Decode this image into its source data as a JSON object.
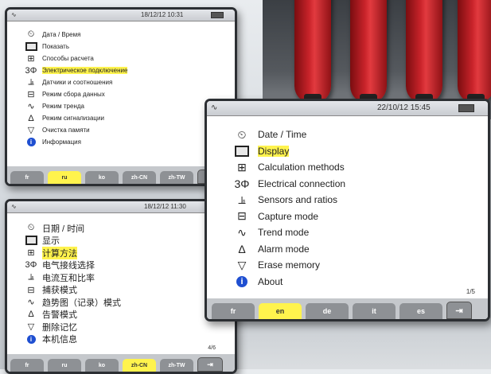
{
  "screen_ru": {
    "datetime": "18/12/12 10:31",
    "items": [
      {
        "icon": "clock-icon",
        "label": "Дата / Время"
      },
      {
        "icon": "display-icon",
        "label": "Показать"
      },
      {
        "icon": "calculation-icon",
        "label": "Способы расчета"
      },
      {
        "icon": "three-phase-icon",
        "label": "Электрическое подключение"
      },
      {
        "icon": "sensor-icon",
        "label": "Датчики и соотношения"
      },
      {
        "icon": "capture-icon",
        "label": "Режим сбора данных"
      },
      {
        "icon": "trend-icon",
        "label": "Режим тренда"
      },
      {
        "icon": "alarm-bell-icon",
        "label": "Режим сигнализации"
      },
      {
        "icon": "trash-icon",
        "label": "Очистка памяти"
      },
      {
        "icon": "info-icon",
        "label": "Информация"
      }
    ],
    "selected_index": 3,
    "tabs": [
      "fr",
      "ru",
      "ko",
      "zh-CN",
      "zh-TW"
    ],
    "selected_tab": 1
  },
  "screen_zh": {
    "datetime": "18/12/12 11:30",
    "items": [
      {
        "icon": "clock-icon",
        "label": "日期 / 时间"
      },
      {
        "icon": "display-icon",
        "label": "显示"
      },
      {
        "icon": "calculation-icon",
        "label": "计算方法"
      },
      {
        "icon": "three-phase-icon",
        "label": "电气接线选择"
      },
      {
        "icon": "sensor-icon",
        "label": "电流互和比率"
      },
      {
        "icon": "capture-icon",
        "label": "捕获模式"
      },
      {
        "icon": "trend-icon",
        "label": "趋势图（记录）模式"
      },
      {
        "icon": "alarm-bell-icon",
        "label": "告警模式"
      },
      {
        "icon": "trash-icon",
        "label": "删除记忆"
      },
      {
        "icon": "info-icon",
        "label": "本机信息"
      }
    ],
    "selected_index": 2,
    "tabs": [
      "fr",
      "ru",
      "ko",
      "zh-CN",
      "zh-TW"
    ],
    "selected_tab": 3,
    "page_indicator": "4/6"
  },
  "screen_en": {
    "datetime": "22/10/12 15:45",
    "items": [
      {
        "icon": "clock-icon",
        "label": "Date / Time"
      },
      {
        "icon": "display-icon",
        "label": "Display"
      },
      {
        "icon": "calculation-icon",
        "label": "Calculation methods"
      },
      {
        "icon": "three-phase-icon",
        "label": "Electrical connection"
      },
      {
        "icon": "sensor-icon",
        "label": "Sensors and ratios"
      },
      {
        "icon": "capture-icon",
        "label": "Capture mode"
      },
      {
        "icon": "trend-icon",
        "label": "Trend mode"
      },
      {
        "icon": "alarm-bell-icon",
        "label": "Alarm mode"
      },
      {
        "icon": "trash-icon",
        "label": "Erase memory"
      },
      {
        "icon": "info-icon",
        "label": "About"
      }
    ],
    "selected_index": 1,
    "tabs": [
      "fr",
      "en",
      "de",
      "it",
      "es"
    ],
    "selected_tab": 1,
    "page_indicator": "1/5"
  },
  "icon_glyphs": {
    "clock-icon": "⏲",
    "display-icon": "▣",
    "calculation-icon": "⊞",
    "three-phase-icon": "3Φ",
    "sensor-icon": "⫡",
    "capture-icon": "⊟",
    "trend-icon": "∿",
    "alarm-bell-icon": "Δ",
    "trash-icon": "▽",
    "info-icon": "i"
  },
  "colors": {
    "highlight": "#fff34d",
    "tab": "#8e9195",
    "bezel": "#2c2f33",
    "info_blue": "#1f4fd1"
  }
}
